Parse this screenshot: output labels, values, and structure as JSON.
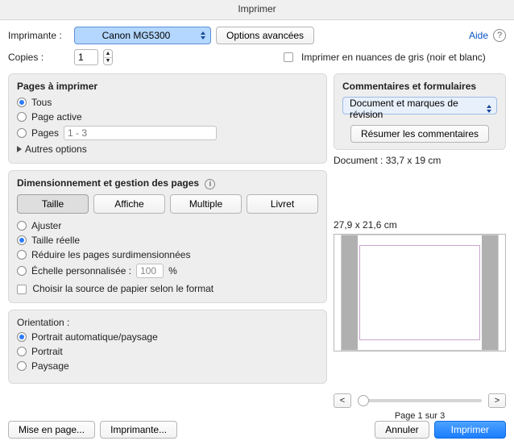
{
  "title": "Imprimer",
  "top": {
    "printer_label": "Imprimante :",
    "printer_value": "Canon MG5300",
    "advanced_btn": "Options avancées",
    "help_link": "Aide",
    "copies_label": "Copies :",
    "copies_value": "1",
    "grayscale_label": "Imprimer en nuances de gris (noir et blanc)"
  },
  "pages": {
    "heading": "Pages à imprimer",
    "all": "Tous",
    "current": "Page active",
    "range_label": "Pages",
    "range_placeholder": "1 - 3",
    "more": "Autres options"
  },
  "sizing": {
    "heading": "Dimensionnement et gestion des pages",
    "tabs": {
      "size": "Taille",
      "poster": "Affiche",
      "multiple": "Multiple",
      "booklet": "Livret"
    },
    "fit": "Ajuster",
    "actual": "Taille réelle",
    "shrink": "Réduire les pages surdimensionnées",
    "custom": "Échelle personnalisée :",
    "custom_value": "100",
    "custom_pct": "%",
    "paper_source": "Choisir la source de papier selon le format"
  },
  "orient": {
    "heading": "Orientation :",
    "auto": "Portrait automatique/paysage",
    "portrait": "Portrait",
    "landscape": "Paysage"
  },
  "comments": {
    "heading": "Commentaires et formulaires",
    "value": "Document et marques de révision",
    "summarize_btn": "Résumer les commentaires"
  },
  "preview": {
    "doc_dims": "Document : 33,7 x 19 cm",
    "paper_dims": "27,9 x 21,6 cm",
    "page_label": "Page 1 sur 3"
  },
  "footer": {
    "page_setup": "Mise en page...",
    "printer_btn": "Imprimante...",
    "cancel": "Annuler",
    "print": "Imprimer"
  }
}
